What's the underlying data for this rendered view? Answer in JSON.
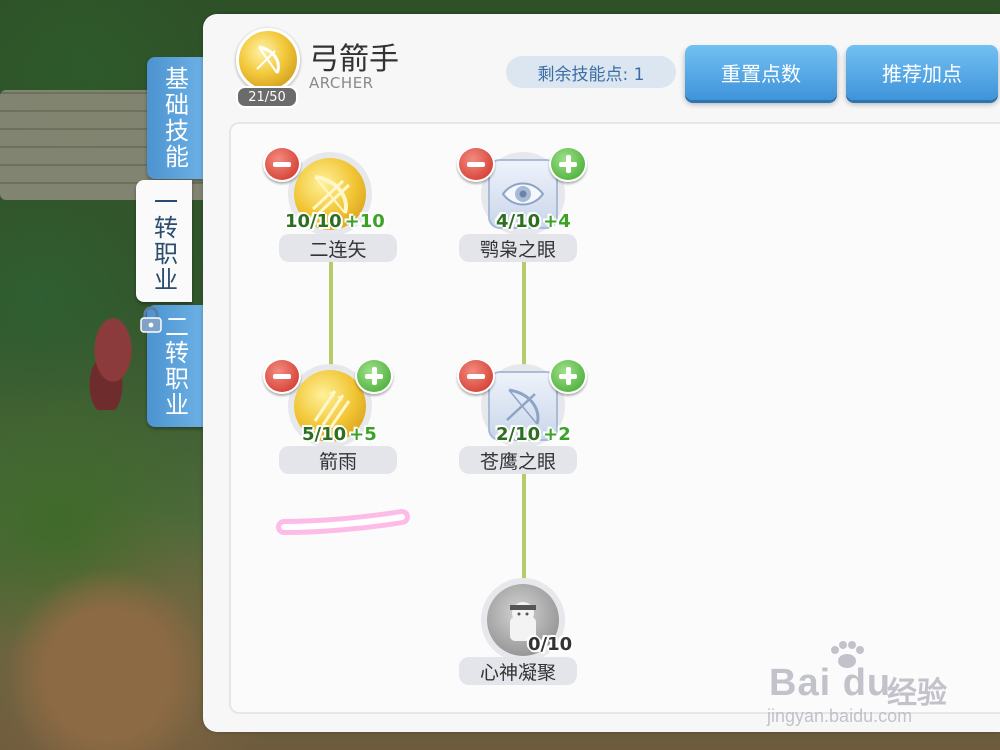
{
  "tabs": [
    {
      "label": "基础技能",
      "active": false,
      "locked": false
    },
    {
      "label": "一转职业",
      "active": true,
      "locked": false
    },
    {
      "label": "二转职业",
      "active": false,
      "locked": true
    }
  ],
  "header": {
    "class_name": "弓箭手",
    "class_subtitle": "ARCHER",
    "level": "21/50",
    "skill_points_label": "剩余技能点: 1",
    "reset_button": "重置点数",
    "recommend_button": "推荐加点"
  },
  "skills": [
    {
      "name": "二连矢",
      "level": "10/10",
      "bonus": "+10",
      "style": "gold",
      "icon": "bow-icon",
      "has_minus": true,
      "has_plus": false
    },
    {
      "name": "箭雨",
      "level": "5/10",
      "bonus": "+5",
      "style": "gold",
      "icon": "arrow-rain-icon",
      "has_minus": true,
      "has_plus": true
    },
    {
      "name": "鹗枭之眼",
      "level": "4/10",
      "bonus": "+4",
      "style": "silver",
      "icon": "eye-icon",
      "has_minus": true,
      "has_plus": true
    },
    {
      "name": "苍鹰之眼",
      "level": "2/10",
      "bonus": "+2",
      "style": "silver",
      "icon": "bow-icon",
      "has_minus": true,
      "has_plus": true
    },
    {
      "name": "心神凝聚",
      "level": "0/10",
      "bonus": "",
      "style": "grey",
      "icon": "character-icon",
      "has_minus": false,
      "has_plus": false
    }
  ],
  "colors": {
    "button_blue": "#3f93d9",
    "connector": "#b6cc6b",
    "level_green": "#2d6e1f",
    "bonus_green": "#3aa326",
    "highlight_pink": "#ff6fd0"
  },
  "watermark": {
    "main": "Bai du",
    "cn": "经验",
    "url": "jingyan.baidu.com"
  }
}
